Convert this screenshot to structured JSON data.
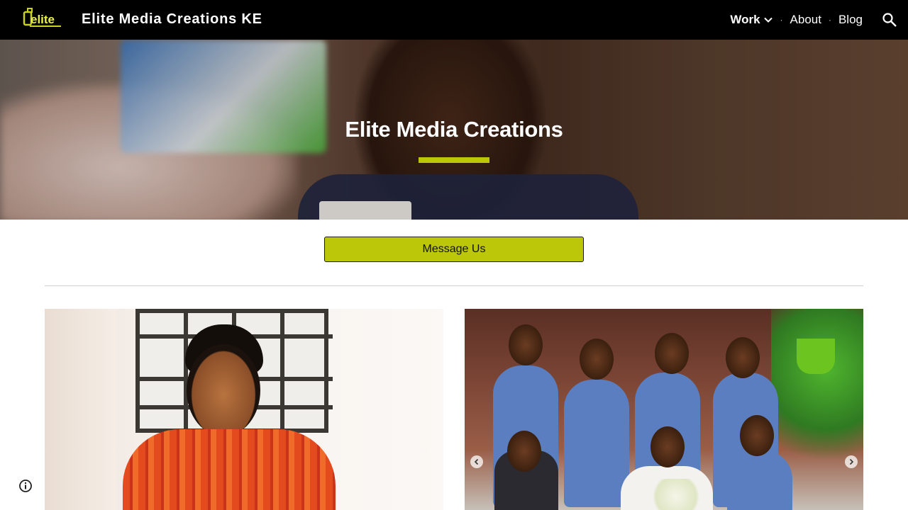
{
  "header": {
    "logo_text": "elite",
    "site_title": "Elite Media Creations KE",
    "nav": [
      {
        "label": "Work",
        "active": true,
        "has_dropdown": true
      },
      {
        "label": "About",
        "active": false
      },
      {
        "label": "Blog",
        "active": false
      }
    ],
    "search_icon": "search-icon"
  },
  "hero": {
    "title": "Elite Media Creations",
    "accent_color": "#bcc70a"
  },
  "cta": {
    "label": "Message Us",
    "color": "#bcc70a"
  },
  "footer": {
    "info_icon": "info-icon"
  }
}
